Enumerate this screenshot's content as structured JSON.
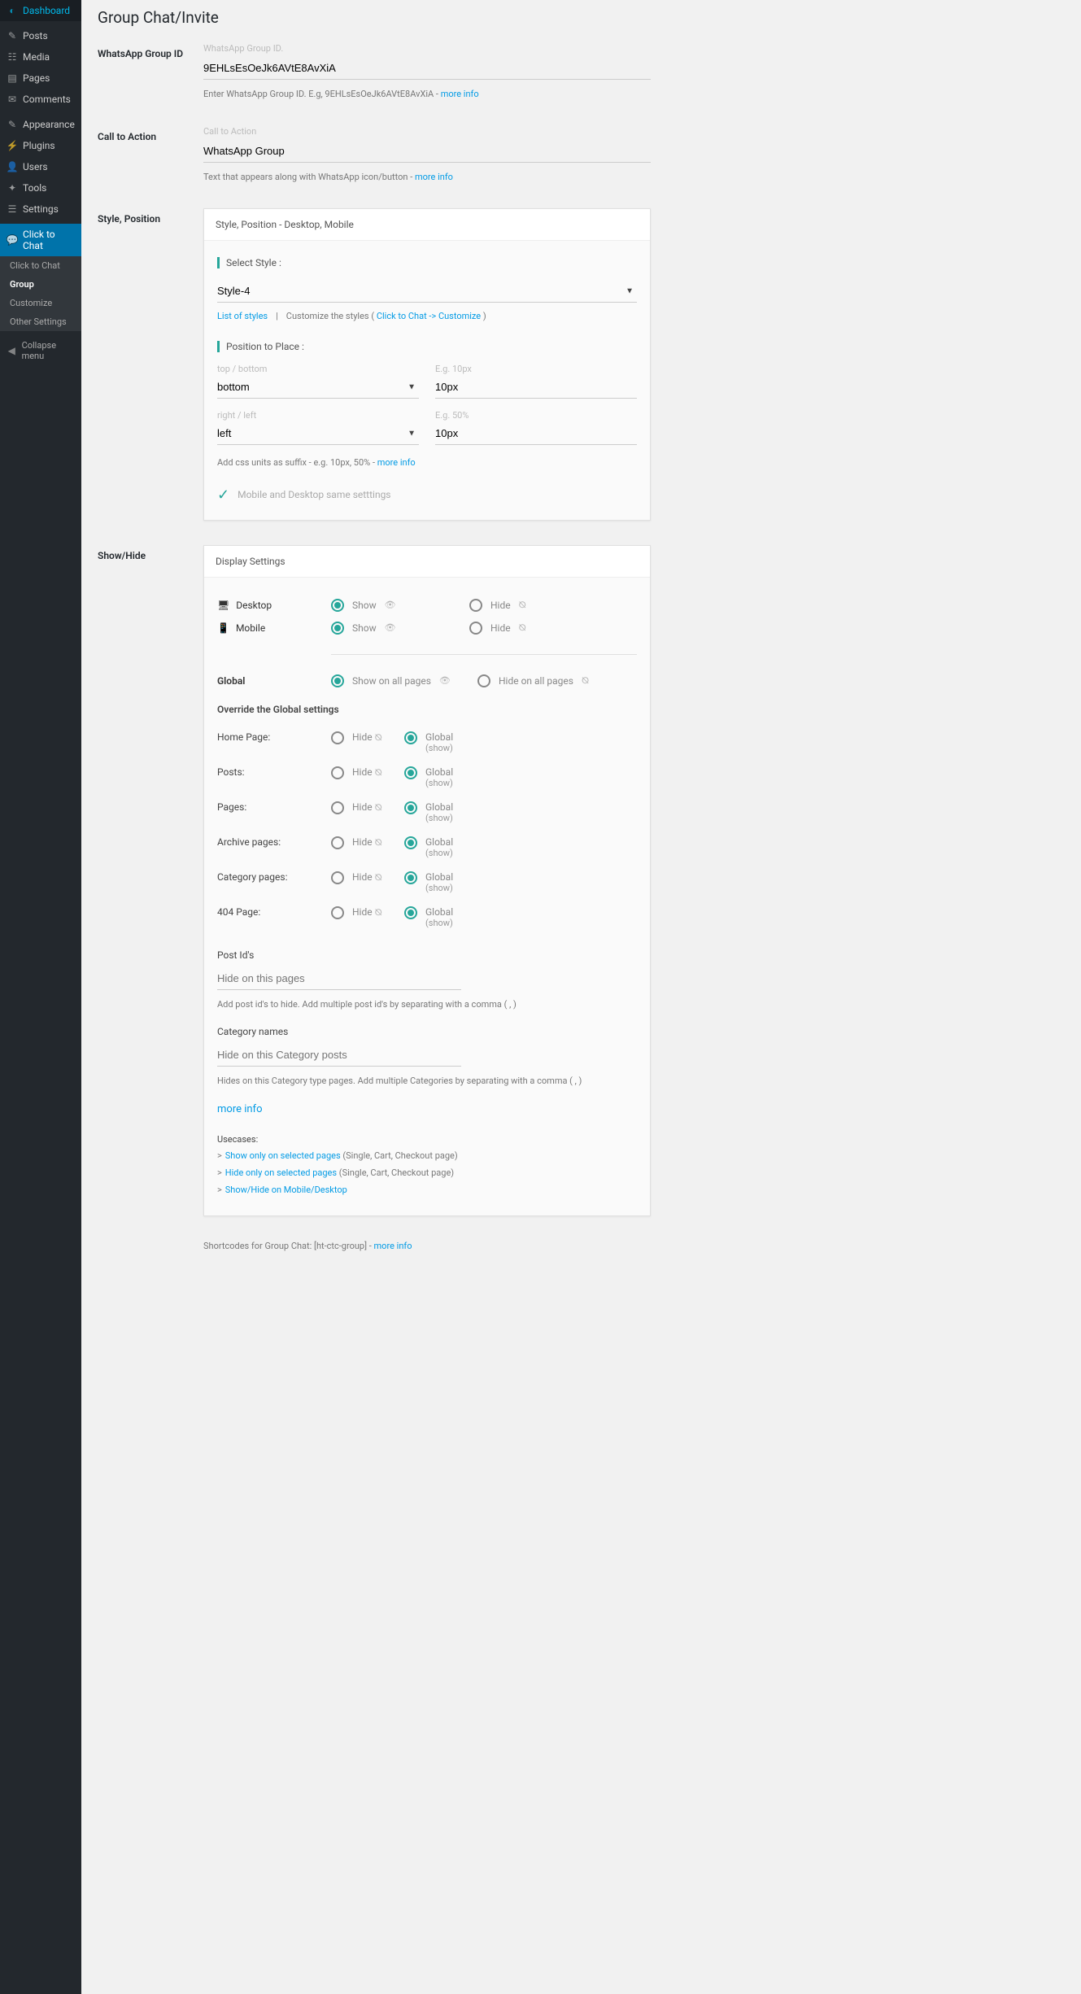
{
  "sidebar": {
    "items": [
      {
        "icon": "⚙",
        "label": "Dashboard"
      },
      {
        "icon": "📌",
        "label": "Posts"
      },
      {
        "icon": "🖼",
        "label": "Media"
      },
      {
        "icon": "📄",
        "label": "Pages"
      },
      {
        "icon": "💬",
        "label": "Comments"
      },
      {
        "icon": "🎨",
        "label": "Appearance"
      },
      {
        "icon": "🔌",
        "label": "Plugins"
      },
      {
        "icon": "👤",
        "label": "Users"
      },
      {
        "icon": "🔧",
        "label": "Tools"
      },
      {
        "icon": "⚙",
        "label": "Settings"
      },
      {
        "icon": "💬",
        "label": "Click to Chat"
      }
    ],
    "submenu": [
      "Click to Chat",
      "Group",
      "Customize",
      "Other Settings"
    ],
    "collapse": "Collapse menu"
  },
  "page": {
    "title": "Group Chat/Invite"
  },
  "group_id": {
    "label": "WhatsApp Group ID",
    "small": "WhatsApp Group ID.",
    "value": "9EHLsEsOeJk6AVtE8AvXiA",
    "help_pre": "Enter WhatsApp Group ID. E.g, 9EHLsEsOeJk6AVtE8AvXiA - ",
    "help_link": "more info"
  },
  "cta": {
    "label": "Call to Action",
    "small": "Call to Action",
    "value": "WhatsApp Group",
    "help_pre": "Text that appears along with WhatsApp icon/button - ",
    "help_link": "more info"
  },
  "style": {
    "section_label": "Style, Position",
    "header": "Style, Position - Desktop, Mobile",
    "select_label": "Select Style :",
    "select_value": "Style-4",
    "list_link": "List of styles",
    "customize_pre": "Customize the styles ( ",
    "customize_link": "Click to Chat -> Customize",
    "customize_post": " )",
    "position_label": "Position to Place :",
    "tb_label": "top / bottom",
    "tb_value": "bottom",
    "tb_eg": "E.g. 10px",
    "tb_offset": "10px",
    "rl_label": "right / left",
    "rl_value": "left",
    "rl_eg": "E.g. 50%",
    "rl_offset": "10px",
    "suffix_help": "Add css units as suffix - e.g. 10px, 50% - ",
    "suffix_link": "more info",
    "same_settings": "Mobile and Desktop same setttings"
  },
  "showhide": {
    "section_label": "Show/Hide",
    "header": "Display Settings",
    "desktop": "Desktop",
    "mobile": "Mobile",
    "show": "Show",
    "hide": "Hide",
    "global": "Global",
    "show_all": "Show on all pages",
    "hide_all": "Hide on all pages",
    "override_title": "Override the Global settings",
    "rows": [
      {
        "label": "Home Page:"
      },
      {
        "label": "Posts:"
      },
      {
        "label": "Pages:"
      },
      {
        "label": "Archive pages:"
      },
      {
        "label": "Category pages:"
      },
      {
        "label": "404 Page:"
      }
    ],
    "hide_opt": "Hide",
    "global_opt": "Global",
    "global_sub": "(show)",
    "post_ids_label": "Post Id's",
    "post_ids_placeholder": "Hide on this pages",
    "post_ids_help": "Add post id's to hide. Add multiple post id's by separating with a comma ( , )",
    "cat_label": "Category names",
    "cat_placeholder": "Hide on this Category posts",
    "cat_help": "Hides on this Category type pages. Add multiple Categories by separating with a comma ( , )",
    "more_info": "more info",
    "usecases_title": "Usecases:",
    "uc1_link": "Show only on selected pages",
    "uc1_rest": " (Single, Cart, Checkout page)",
    "uc2_link": "Hide only on selected pages",
    "uc2_rest": " (Single, Cart, Checkout page)",
    "uc3_link": "Show/Hide on Mobile/Desktop"
  },
  "shortcode": {
    "text": "Shortcodes for Group Chat: [ht-ctc-group] - ",
    "link": "more info"
  }
}
